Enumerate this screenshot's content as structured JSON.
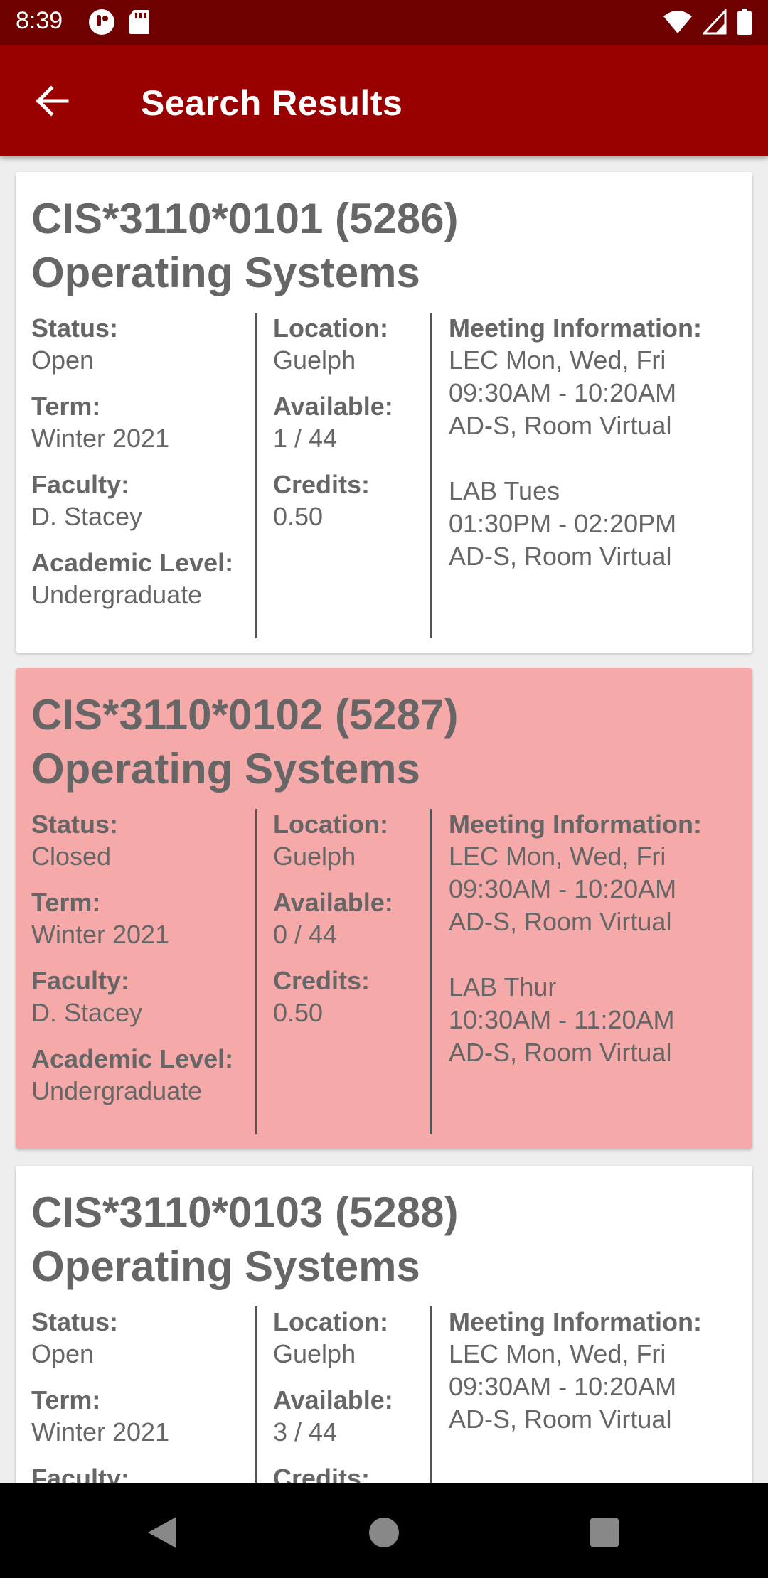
{
  "status_bar": {
    "time": "8:39"
  },
  "app_bar": {
    "title": "Search Results"
  },
  "labels": {
    "status": "Status:",
    "term": "Term:",
    "faculty": "Faculty:",
    "academic_level": "Academic Level:",
    "location": "Location:",
    "available": "Available:",
    "credits": "Credits:",
    "meeting_information": "Meeting Information:"
  },
  "results": [
    {
      "code": "CIS*3110*0101 (5286)",
      "name": "Operating Systems",
      "status": "Open",
      "term": "Winter 2021",
      "faculty": "D. Stacey",
      "academic_level": "Undergraduate",
      "location": "Guelph",
      "available": "1 / 44",
      "credits": "0.50",
      "meetings": [
        "LEC Mon, Wed, Fri\n09:30AM - 10:20AM\nAD-S, Room Virtual",
        "LAB Tues\n01:30PM - 02:20PM\nAD-S, Room Virtual"
      ]
    },
    {
      "code": "CIS*3110*0102 (5287)",
      "name": "Operating Systems",
      "status": "Closed",
      "term": "Winter 2021",
      "faculty": "D. Stacey",
      "academic_level": "Undergraduate",
      "location": "Guelph",
      "available": "0 / 44",
      "credits": "0.50",
      "meetings": [
        "LEC Mon, Wed, Fri\n09:30AM - 10:20AM\nAD-S, Room Virtual",
        "LAB Thur\n10:30AM - 11:20AM\nAD-S, Room Virtual"
      ]
    },
    {
      "code": "CIS*3110*0103 (5288)",
      "name": "Operating Systems",
      "status": "Open",
      "term": "Winter 2021",
      "faculty": "",
      "academic_level": "",
      "location": "Guelph",
      "available": "3 / 44",
      "credits": "",
      "meetings": [
        "LEC Mon, Wed, Fri\n09:30AM - 10:20AM\nAD-S, Room Virtual",
        ""
      ]
    }
  ],
  "colors": {
    "status_bar": "#6e0000",
    "app_bar": "#990000",
    "closed_card": "#f5a9a9",
    "open_card": "#ffffff"
  },
  "icons": {
    "back": "arrow-left-icon",
    "nav_back": "triangle-back-icon",
    "nav_home": "circle-home-icon",
    "nav_recents": "square-recents-icon"
  }
}
